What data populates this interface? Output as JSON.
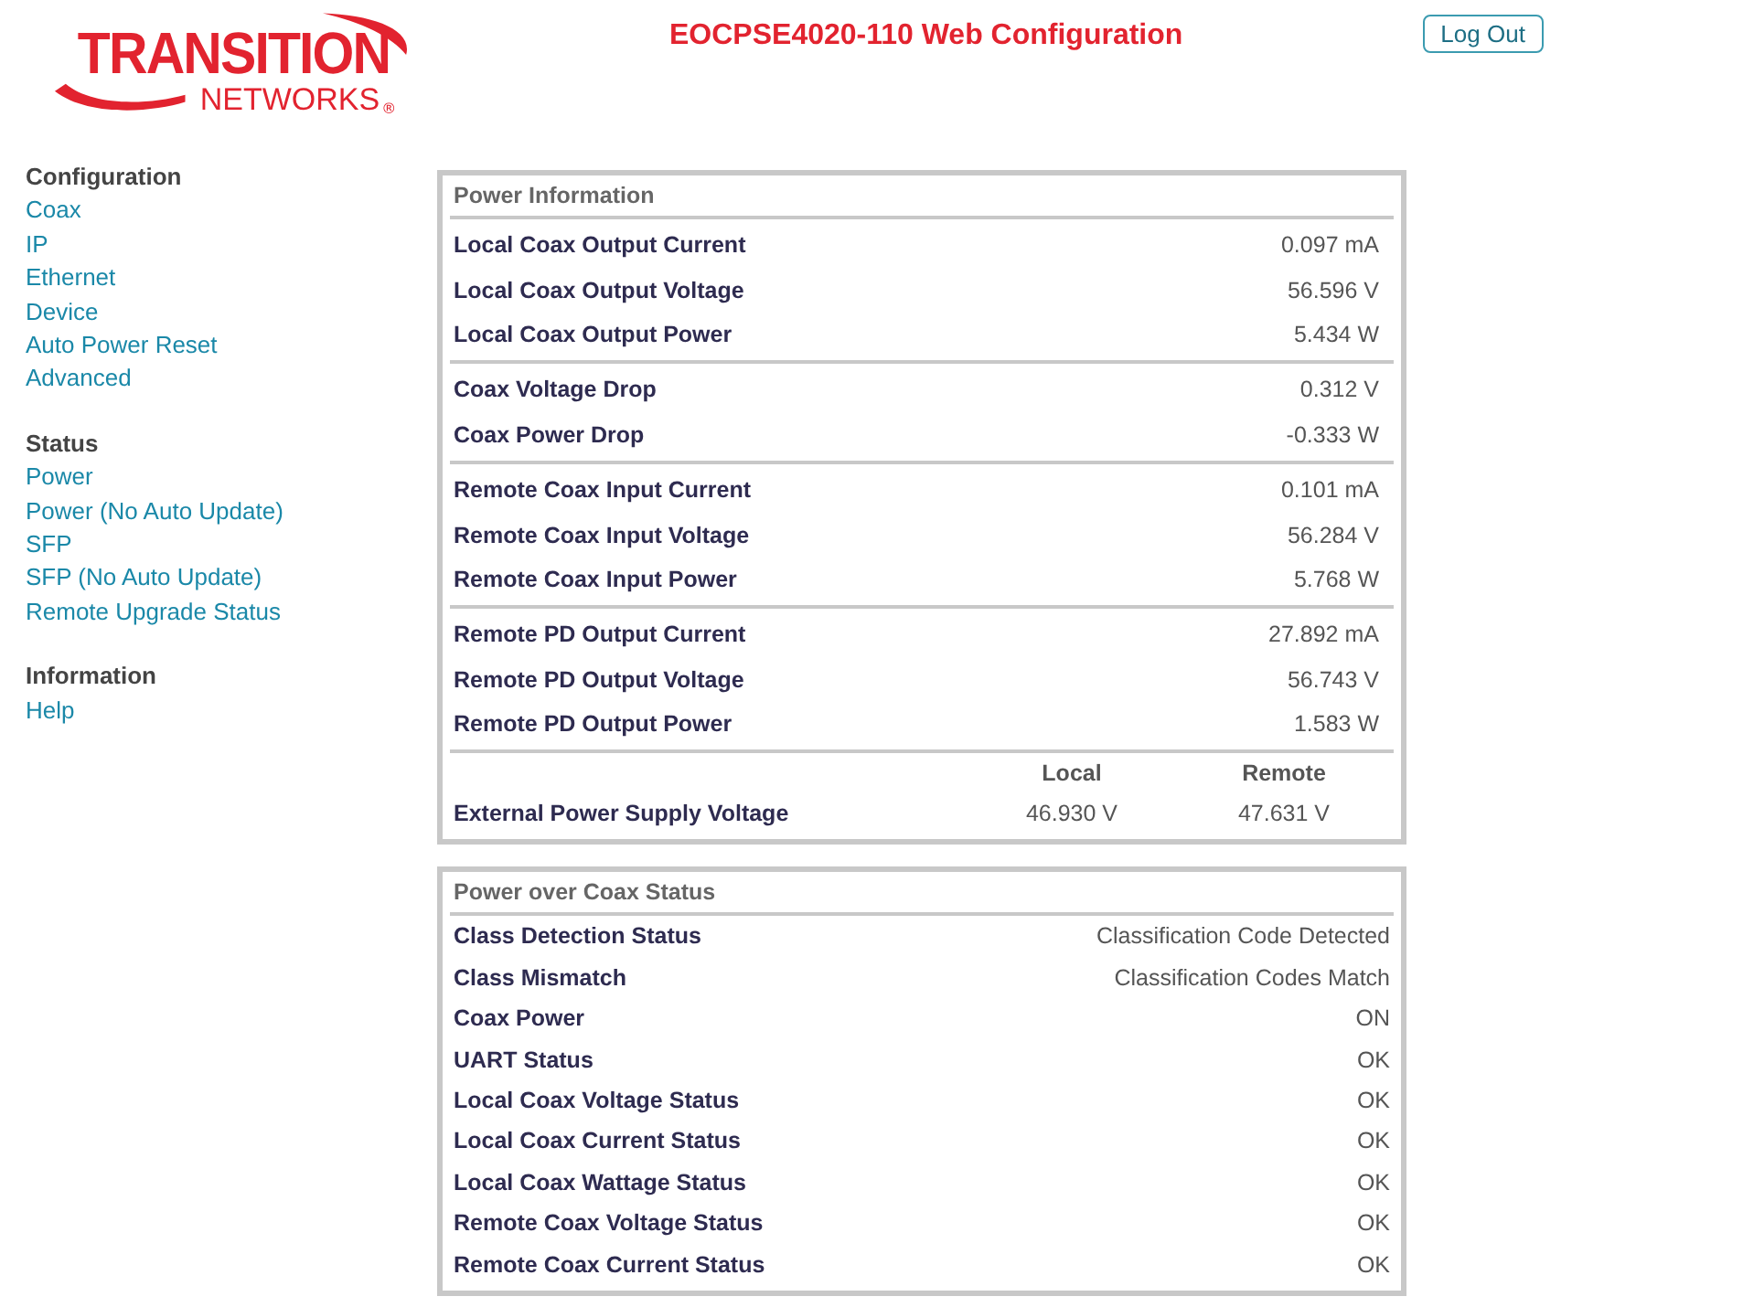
{
  "header": {
    "logo": {
      "main": "TRANSITION",
      "sub": "NETWORKS",
      "mark": "®"
    },
    "title": "EOCPSE4020-110 Web Configuration",
    "logout_button": "Log Out"
  },
  "sidebar": {
    "sections": [
      {
        "heading": "Configuration",
        "items": [
          "Coax",
          "IP",
          "Ethernet",
          "Device",
          "Auto Power Reset",
          "Advanced"
        ]
      },
      {
        "heading": "Status",
        "items": [
          "Power",
          "Power (No Auto Update)",
          "SFP",
          "SFP (No Auto Update)",
          "Remote Upgrade Status"
        ]
      },
      {
        "heading": "Information",
        "items": [
          "Help"
        ]
      }
    ]
  },
  "power_information": {
    "title": "Power Information",
    "groups": [
      {
        "rows": [
          {
            "label": "Local Coax Output Current",
            "value": "0.097 mA"
          },
          {
            "label": "Local Coax Output Voltage",
            "value": "56.596 V"
          },
          {
            "label": "Local Coax Output Power",
            "value": "5.434 W"
          }
        ]
      },
      {
        "rows": [
          {
            "label": "Coax Voltage Drop",
            "value": "0.312 V"
          },
          {
            "label": "Coax Power Drop",
            "value": "-0.333 W"
          }
        ]
      },
      {
        "rows": [
          {
            "label": "Remote Coax Input Current",
            "value": "0.101 mA"
          },
          {
            "label": "Remote Coax Input Voltage",
            "value": "56.284 V"
          },
          {
            "label": "Remote Coax Input Power",
            "value": "5.768 W"
          }
        ]
      },
      {
        "rows": [
          {
            "label": "Remote PD Output Current",
            "value": "27.892 mA"
          },
          {
            "label": "Remote PD Output Voltage",
            "value": "56.743 V"
          },
          {
            "label": "Remote PD Output Power",
            "value": "1.583 W"
          }
        ]
      }
    ],
    "external": {
      "columns": [
        "Local",
        "Remote"
      ],
      "label": "External Power Supply Voltage",
      "values": [
        "46.930 V",
        "47.631 V"
      ]
    }
  },
  "poc_status": {
    "title": "Power over Coax Status",
    "rows": [
      {
        "label": "Class Detection Status",
        "value": "Classification Code Detected"
      },
      {
        "label": "Class Mismatch",
        "value": "Classification Codes Match"
      },
      {
        "label": "Coax Power",
        "value": "ON"
      },
      {
        "label": "UART Status",
        "value": "OK"
      },
      {
        "label": "Local Coax Voltage Status",
        "value": "OK"
      },
      {
        "label": "Local Coax Current Status",
        "value": "OK"
      },
      {
        "label": "Local Coax Wattage Status",
        "value": "OK"
      },
      {
        "label": "Remote Coax Voltage Status",
        "value": "OK"
      },
      {
        "label": "Remote Coax Current Status",
        "value": "OK"
      }
    ]
  }
}
